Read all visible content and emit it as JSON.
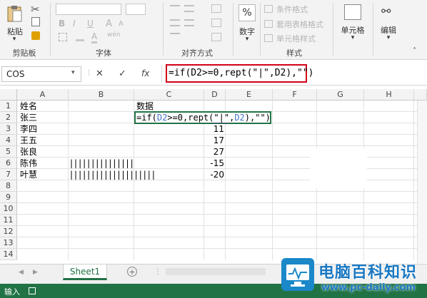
{
  "ribbon": {
    "clipboard": {
      "paste_label": "粘贴",
      "group_label": "剪贴板"
    },
    "font": {
      "group_label": "字体",
      "bold": "B",
      "italic": "I",
      "underline": "U",
      "font_size_up": "A",
      "font_size_down": "A",
      "color_a": "A",
      "wen": "wén"
    },
    "alignment": {
      "group_label": "对齐方式"
    },
    "number": {
      "label": "数字",
      "percent": "%"
    },
    "styles": {
      "group_label": "样式",
      "conditional": "条件格式",
      "table_format": "套用表格格式",
      "cell_styles": "单元格样式"
    },
    "cells": {
      "label": "单元格"
    },
    "editing": {
      "label": "编辑"
    }
  },
  "formula_bar": {
    "name_box": "COS",
    "cancel": "✕",
    "enter": "✓",
    "fx": "fx",
    "formula": "=if(D2>=0,rept(\"|\",D2),\"\")",
    "highlight_color": "#d0021b"
  },
  "columns": [
    "A",
    "B",
    "C",
    "D",
    "E",
    "F",
    "G",
    "H"
  ],
  "rows": [
    "1",
    "2",
    "3",
    "4",
    "5",
    "6",
    "7",
    "8",
    "9",
    "10",
    "11",
    "12",
    "13",
    "14"
  ],
  "cells": {
    "A1": "姓名",
    "C1": "数据",
    "A2": "张三",
    "A3": "李四",
    "D3": "11",
    "A4": "王五",
    "D4": "17",
    "A5": "张良",
    "D5": "27",
    "A6": "陈伟",
    "D6": "-15",
    "A7": "叶慧",
    "D7": "-20",
    "B6": "|||||||||||||||",
    "B7": "||||||||||||||||||||",
    "C2_edit": {
      "p1": "=if(",
      "ref1": "D2",
      "p2": ">=0,rept(",
      "str1": "\"|\"",
      "p3": ",",
      "ref2": "D2",
      "p4": "),\"\")"
    }
  },
  "sheet_tabs": {
    "active": "Sheet1",
    "add": "+"
  },
  "status": {
    "mode": "输入"
  },
  "watermark": {
    "cn": "电脑百科知识",
    "url": "www.pc-daily.com"
  },
  "colors": {
    "excel_green": "#217346",
    "ref_blue": "#4472c4",
    "ref_purple": "#7030a0",
    "selection": "#217346"
  }
}
